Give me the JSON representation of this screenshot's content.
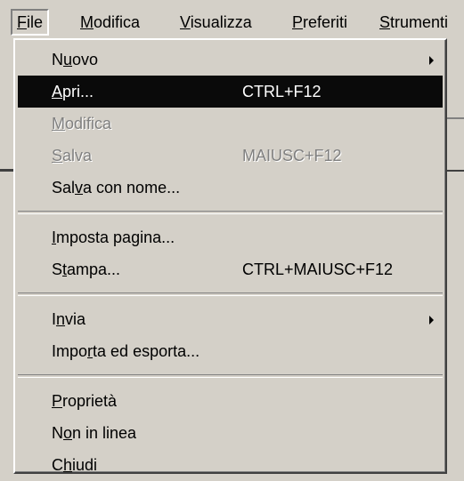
{
  "menubar": {
    "items": [
      {
        "before": "",
        "accel": "F",
        "after": "ile"
      },
      {
        "before": "",
        "accel": "M",
        "after": "odifica"
      },
      {
        "before": "",
        "accel": "V",
        "after": "isualizza"
      },
      {
        "before": "",
        "accel": "P",
        "after": "referiti"
      },
      {
        "before": "",
        "accel": "S",
        "after": "trumenti"
      }
    ]
  },
  "file_menu": {
    "items": [
      {
        "before": "N",
        "accel": "u",
        "after": "ovo",
        "shortcut": "",
        "submenu": true
      },
      {
        "before": "",
        "accel": "A",
        "after": "pri...",
        "shortcut": "CTRL+F12",
        "highlighted": true
      },
      {
        "before": "",
        "accel": "M",
        "after": "odifica",
        "shortcut": "",
        "disabled": true
      },
      {
        "before": "",
        "accel": "S",
        "after": "alva",
        "shortcut": "MAIUSC+F12",
        "disabled": true
      },
      {
        "before": "Sal",
        "accel": "v",
        "after": "a con nome...",
        "shortcut": ""
      },
      {
        "before": "",
        "accel": "I",
        "after": "mposta pagina...",
        "shortcut": ""
      },
      {
        "before": "S",
        "accel": "t",
        "after": "ampa...",
        "shortcut": "CTRL+MAIUSC+F12"
      },
      {
        "before": "I",
        "accel": "n",
        "after": "via",
        "shortcut": "",
        "submenu": true
      },
      {
        "before": "Impo",
        "accel": "r",
        "after": "ta ed esporta...",
        "shortcut": ""
      },
      {
        "before": "",
        "accel": "P",
        "after": "roprietà",
        "shortcut": ""
      },
      {
        "before": "N",
        "accel": "o",
        "after": "n in linea",
        "shortcut": ""
      },
      {
        "before": "C",
        "accel": "h",
        "after": "iudi",
        "shortcut": ""
      }
    ]
  }
}
